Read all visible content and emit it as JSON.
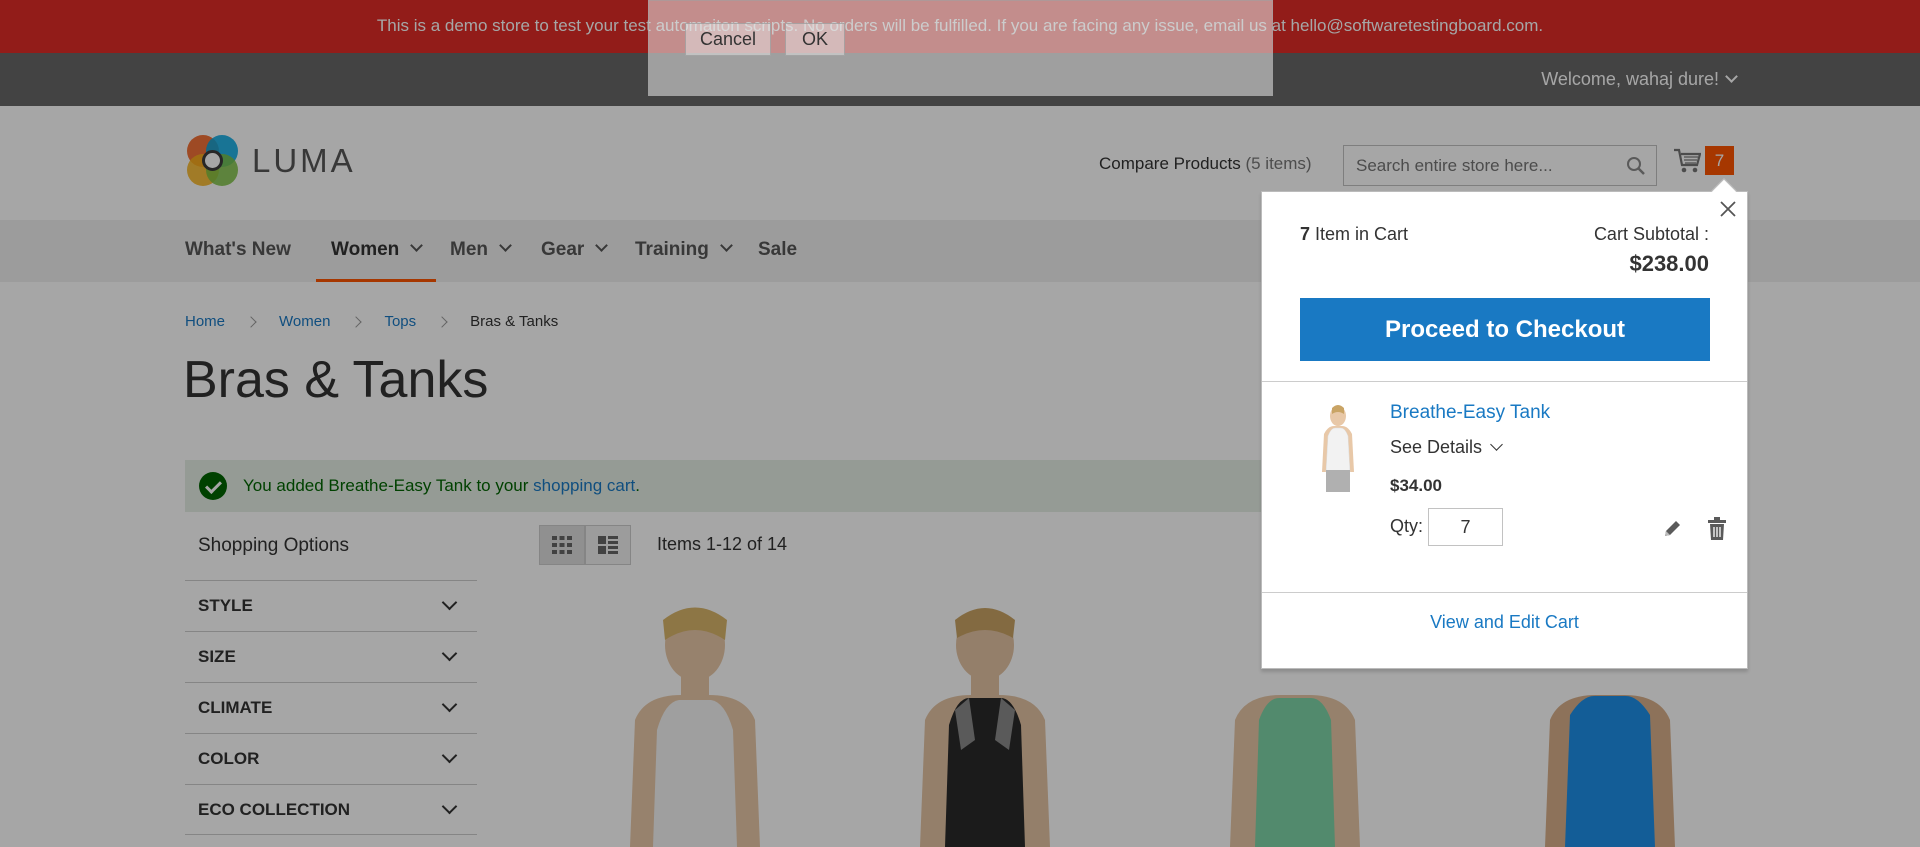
{
  "banner": {
    "text": "This is a demo store to test your test automaiton scripts. No orders will be fulfilled. If you are facing any issue, email us at hello@softwaretestingboard.com."
  },
  "header": {
    "welcome": "Welcome, wahaj dure!",
    "logo_text": "LUMA",
    "compare_label": "Compare Products",
    "compare_count": "(5 items)",
    "search_placeholder": "Search entire store here...",
    "cart_count": "7"
  },
  "nav": {
    "items": [
      {
        "label": "What's New"
      },
      {
        "label": "Women"
      },
      {
        "label": "Men"
      },
      {
        "label": "Gear"
      },
      {
        "label": "Training"
      },
      {
        "label": "Sale"
      }
    ]
  },
  "breadcrumbs": [
    "Home",
    "Women",
    "Tops",
    "Bras & Tanks"
  ],
  "page_title": "Bras & Tanks",
  "message": {
    "prefix": "You added Breathe-Easy Tank to your ",
    "link": "shopping cart",
    "suffix": "."
  },
  "sidebar": {
    "title": "Shopping Options",
    "filters": [
      "STYLE",
      "SIZE",
      "CLIMATE",
      "COLOR",
      "ECO COLLECTION"
    ]
  },
  "toolbar": {
    "amount": "Items 1-12 of 14"
  },
  "dialog": {
    "cancel": "Cancel",
    "ok": "OK"
  },
  "minicart": {
    "count": "7",
    "count_label": " Item in Cart",
    "subtotal_label": "Cart Subtotal :",
    "subtotal": "$238.00",
    "checkout": "Proceed to Checkout",
    "item": {
      "name": "Breathe-Easy Tank",
      "see_details": "See Details",
      "price": "$34.00",
      "qty_label": "Qty:",
      "qty": "7"
    },
    "view_cart": "View and Edit Cart"
  },
  "colors": {
    "banner": "#e02b27",
    "accent": "#ff5501",
    "link": "#1979c3",
    "success_bg": "#e5efe5"
  }
}
